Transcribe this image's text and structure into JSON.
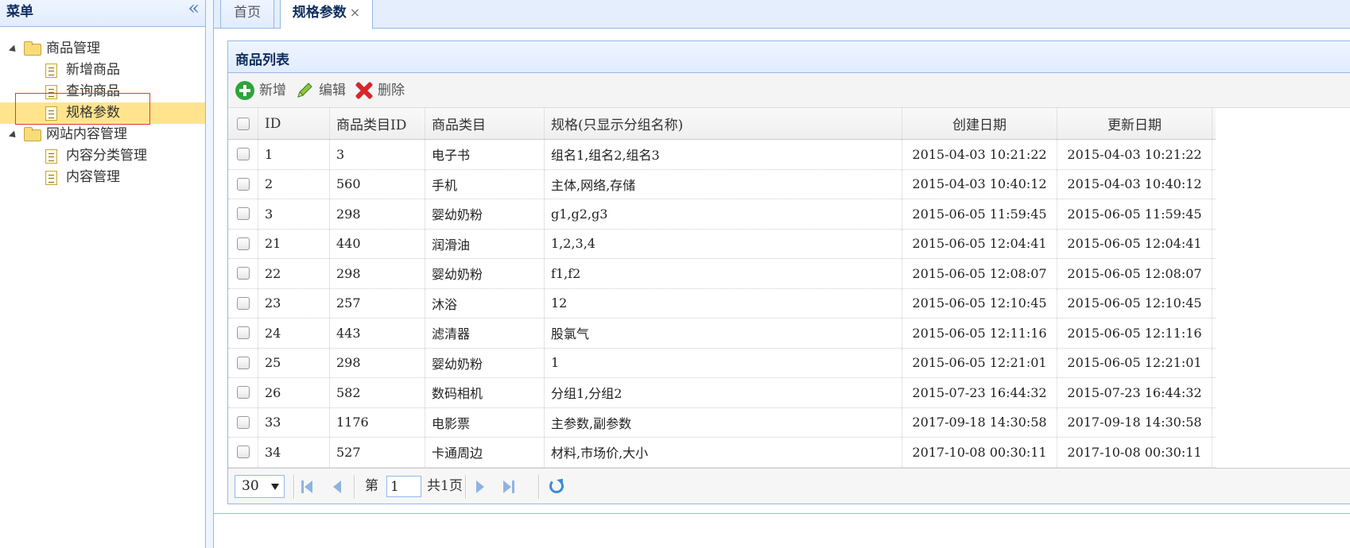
{
  "sidebar": {
    "title": "菜单",
    "tree": [
      {
        "label": "商品管理",
        "type": "folder"
      },
      {
        "label": "新增商品",
        "type": "leaf"
      },
      {
        "label": "查询商品",
        "type": "leaf"
      },
      {
        "label": "规格参数",
        "type": "leaf",
        "selected": true
      },
      {
        "label": "网站内容管理",
        "type": "folder"
      },
      {
        "label": "内容分类管理",
        "type": "leaf"
      },
      {
        "label": "内容管理",
        "type": "leaf"
      }
    ]
  },
  "tabs": [
    {
      "label": "首页",
      "active": false
    },
    {
      "label": "规格参数",
      "active": true,
      "closable": true
    }
  ],
  "panel": {
    "title": "商品列表",
    "toolbar": {
      "add": "新增",
      "edit": "编辑",
      "delete": "删除"
    }
  },
  "grid": {
    "columns": [
      "ID",
      "商品类目ID",
      "商品类目",
      "规格(只显示分组名称)",
      "创建日期",
      "更新日期"
    ],
    "rows": [
      [
        "1",
        "3",
        "电子书",
        "组名1,组名2,组名3",
        "2015-04-03 10:21:22",
        "2015-04-03 10:21:22"
      ],
      [
        "2",
        "560",
        "手机",
        "主体,网络,存储",
        "2015-04-03 10:40:12",
        "2015-04-03 10:40:12"
      ],
      [
        "3",
        "298",
        "婴幼奶粉",
        "g1,g2,g3",
        "2015-06-05 11:59:45",
        "2015-06-05 11:59:45"
      ],
      [
        "21",
        "440",
        "润滑油",
        "1,2,3,4",
        "2015-06-05 12:04:41",
        "2015-06-05 12:04:41"
      ],
      [
        "22",
        "298",
        "婴幼奶粉",
        "f1,f2",
        "2015-06-05 12:08:07",
        "2015-06-05 12:08:07"
      ],
      [
        "23",
        "257",
        "沐浴",
        "12",
        "2015-06-05 12:10:45",
        "2015-06-05 12:10:45"
      ],
      [
        "24",
        "443",
        "滤清器",
        "股氯气",
        "2015-06-05 12:11:16",
        "2015-06-05 12:11:16"
      ],
      [
        "25",
        "298",
        "婴幼奶粉",
        "1",
        "2015-06-05 12:21:01",
        "2015-06-05 12:21:01"
      ],
      [
        "26",
        "582",
        "数码相机",
        "分组1,分组2",
        "2015-07-23 16:44:32",
        "2015-07-23 16:44:32"
      ],
      [
        "33",
        "1176",
        "电影票",
        "主参数,副参数",
        "2017-09-18 14:30:58",
        "2017-09-18 14:30:58"
      ],
      [
        "34",
        "527",
        "卡通周边",
        "材料,市场价,大小",
        "2017-10-08 00:30:11",
        "2017-10-08 00:30:11"
      ]
    ]
  },
  "pager": {
    "page_size": "30",
    "page_prefix": "第",
    "current_page": "1",
    "total_text": "共1页"
  },
  "icons": {
    "collapse": "double-chevron-left-icon",
    "add": "plus-circle-icon",
    "edit": "pencil-icon",
    "delete": "red-x-icon",
    "refresh": "refresh-icon"
  },
  "colors": {
    "border": "#95b8e7",
    "selected": "#ffe48d",
    "header_gradient_top": "#eff5ff",
    "header_gradient_bottom": "#e0ecff",
    "highlight_box": "#e03a3a"
  }
}
